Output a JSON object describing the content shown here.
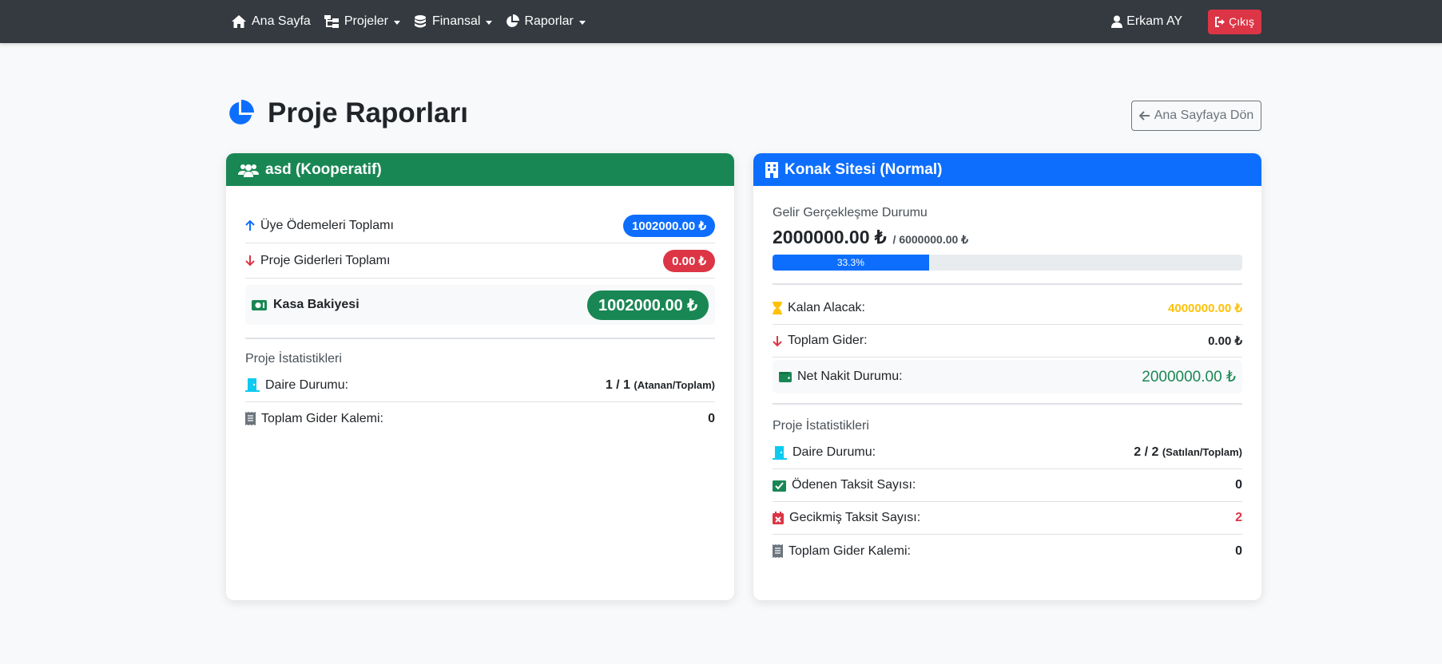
{
  "navbar": {
    "home": "Ana Sayfa",
    "projects": "Projeler",
    "finance": "Finansal",
    "reports": "Raporlar",
    "user": "Erkam AY",
    "logout": "Çıkış"
  },
  "page": {
    "title": "Proje Raporları",
    "back_button": "Ana Sayfaya Dön"
  },
  "colors": {
    "green": "#198754",
    "blue": "#0d6efd",
    "red": "#dc3545",
    "warning": "#ffc107",
    "info": "#0dcaf0",
    "dark": "#343a40"
  },
  "projects": [
    {
      "title": "asd (Kooperatif)",
      "header_color": "#198754",
      "header_icon": "users-icon",
      "member_payments_label": "Üye Ödemeleri Toplamı",
      "member_payments_value": "1002000.00 ₺",
      "expenses_label": "Proje Giderleri Toplamı",
      "expenses_value": "0.00 ₺",
      "cash_label": "Kasa Bakiyesi",
      "cash_value": "1002000.00 ₺",
      "stats_title": "Proje İstatistikleri",
      "unit_label": "Daire Durumu:",
      "unit_value": "1 / 1",
      "unit_suffix": "(Atanan/Toplam)",
      "expense_items_label": "Toplam Gider Kalemi:",
      "expense_items_value": "0"
    },
    {
      "title": "Konak Sitesi (Normal)",
      "header_color": "#0d6efd",
      "header_icon": "building-icon",
      "income_status_label": "Gelir Gerçekleşme Durumu",
      "income_realized": "2000000.00 ₺",
      "income_target": "/ 6000000.00 ₺",
      "progress_label": "33.3%",
      "progress_fraction": 0.333,
      "remaining_label": "Kalan Alacak:",
      "remaining_value": "4000000.00 ₺",
      "total_expense_label": "Toplam Gider:",
      "total_expense_value": "0.00 ₺",
      "net_cash_label": "Net Nakit Durumu:",
      "net_cash_value": "2000000.00 ₺",
      "stats_title": "Proje İstatistikleri",
      "unit_label": "Daire Durumu:",
      "unit_value": "2 / 2",
      "unit_suffix": "(Satılan/Toplam)",
      "paid_installments_label": "Ödenen Taksit Sayısı:",
      "paid_installments_value": "0",
      "overdue_installments_label": "Gecikmiş Taksit Sayısı:",
      "overdue_installments_value": "2",
      "expense_items_label": "Toplam Gider Kalemi:",
      "expense_items_value": "0"
    }
  ]
}
